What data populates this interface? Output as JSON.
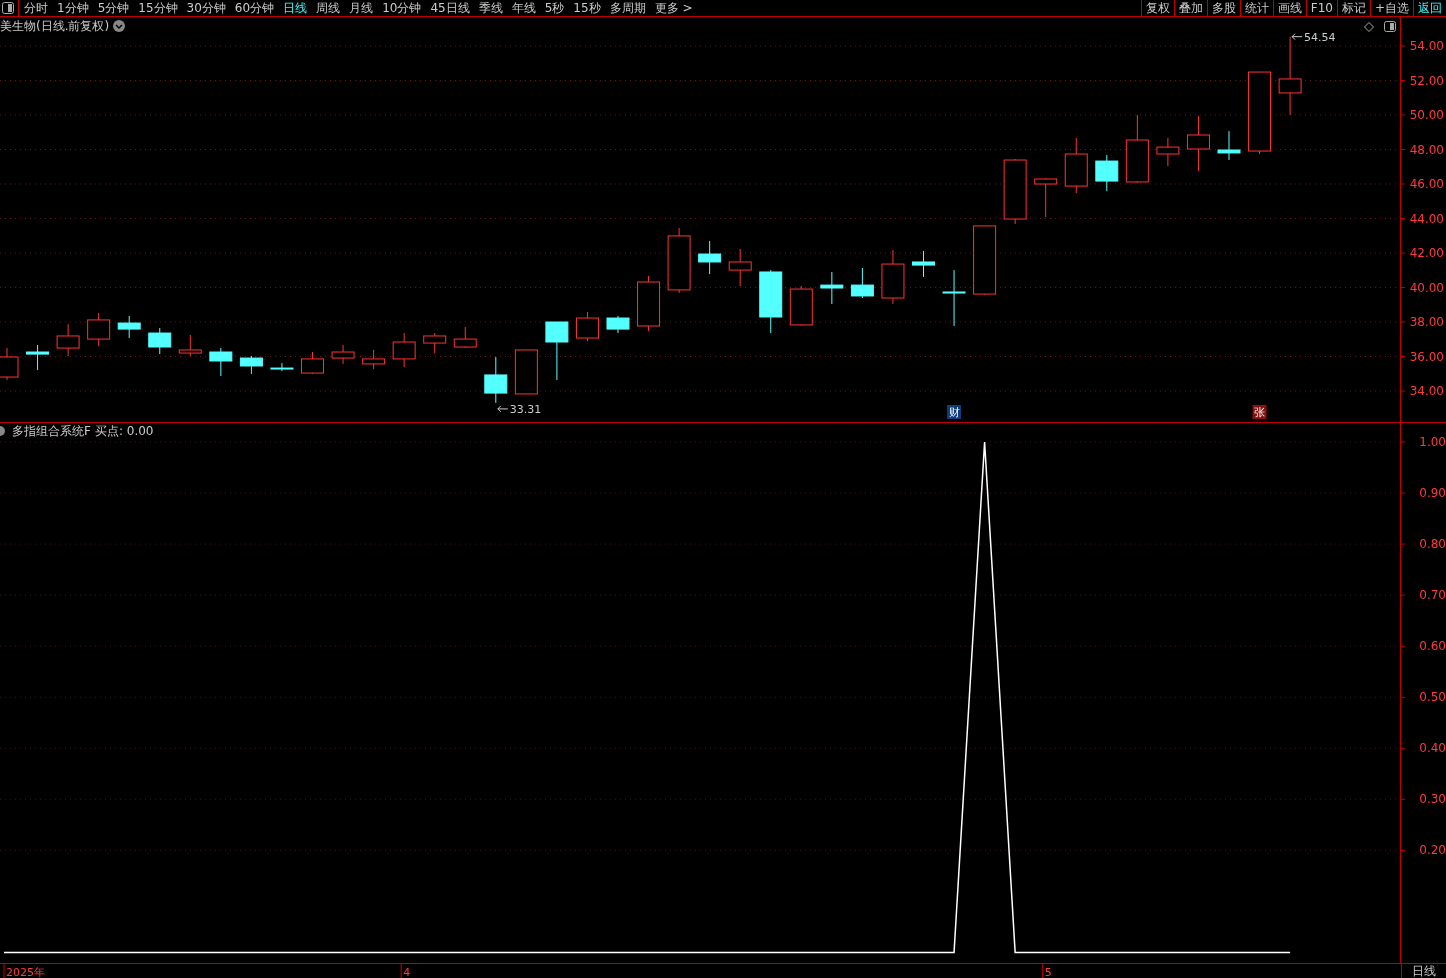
{
  "toolbar": {
    "periods": [
      {
        "label": "分时",
        "selected": false
      },
      {
        "label": "1分钟",
        "selected": false
      },
      {
        "label": "5分钟",
        "selected": false
      },
      {
        "label": "15分钟",
        "selected": false
      },
      {
        "label": "30分钟",
        "selected": false
      },
      {
        "label": "60分钟",
        "selected": false
      },
      {
        "label": "日线",
        "selected": true
      },
      {
        "label": "周线",
        "selected": false
      },
      {
        "label": "月线",
        "selected": false
      },
      {
        "label": "10分钟",
        "selected": false
      },
      {
        "label": "45日线",
        "selected": false
      },
      {
        "label": "季线",
        "selected": false
      },
      {
        "label": "年线",
        "selected": false
      },
      {
        "label": "5秒",
        "selected": false
      },
      {
        "label": "15秒",
        "selected": false
      },
      {
        "label": "多周期",
        "selected": false
      },
      {
        "label": "更多 >",
        "selected": false
      }
    ],
    "buttons": [
      {
        "label": "复权",
        "selected": false
      },
      {
        "label": "叠加",
        "selected": false
      },
      {
        "label": "多股",
        "selected": false
      },
      {
        "label": "统计",
        "selected": false
      },
      {
        "label": "画线",
        "selected": false
      },
      {
        "label": "F10",
        "selected": false
      },
      {
        "label": "标记",
        "selected": false
      },
      {
        "label": "+自选",
        "selected": false
      },
      {
        "label": "返回",
        "selected": true
      }
    ]
  },
  "price_pane": {
    "title": "美生物(日线.前复权)",
    "axis_labels": [
      "54.00",
      "52.00",
      "50.00",
      "48.00",
      "46.00",
      "44.00",
      "42.00",
      "40.00",
      "38.00",
      "36.00",
      "34.00"
    ],
    "extremes": [
      {
        "text": "54.54",
        "kind": "high"
      },
      {
        "text": "33.31",
        "kind": "low"
      }
    ],
    "event_markers": [
      {
        "text": "财",
        "color": "#0f3d7c"
      },
      {
        "text": "张",
        "color": "#8a0f0f"
      }
    ]
  },
  "indicator_pane": {
    "name": "多指组合系统F",
    "reading": "买点: 0.00",
    "chart_data": {
      "type": "line",
      "ylim": [
        -0.05,
        1
      ],
      "grid": true,
      "yticks": [
        {
          "value": 1,
          "label": "1.00"
        },
        {
          "value": 0.9,
          "label": "0.90"
        },
        {
          "value": 0.8,
          "label": "0.80"
        },
        {
          "value": 0.7,
          "label": "0.70"
        },
        {
          "value": 0.6,
          "label": "0.60"
        },
        {
          "value": 0.5,
          "label": "0.50"
        },
        {
          "value": 0.4,
          "label": "0.40"
        },
        {
          "value": 0.3,
          "label": "0.30"
        },
        {
          "value": 0.2,
          "label": "0.20"
        }
      ],
      "series": [
        {
          "color": "#ffffff",
          "values": [
            0,
            0,
            0,
            0,
            0,
            0,
            0,
            0,
            0,
            0,
            0,
            0,
            0,
            0,
            0,
            0,
            0,
            0,
            0,
            0,
            0,
            0,
            0,
            0,
            0,
            0,
            0,
            0,
            0,
            0,
            0,
            0,
            1,
            0,
            0,
            0,
            0,
            0,
            0,
            0,
            0,
            0,
            0
          ]
        }
      ]
    }
  },
  "x_axis": {
    "labels": [
      "2025年",
      "4",
      "5"
    ],
    "period": "日线"
  }
}
